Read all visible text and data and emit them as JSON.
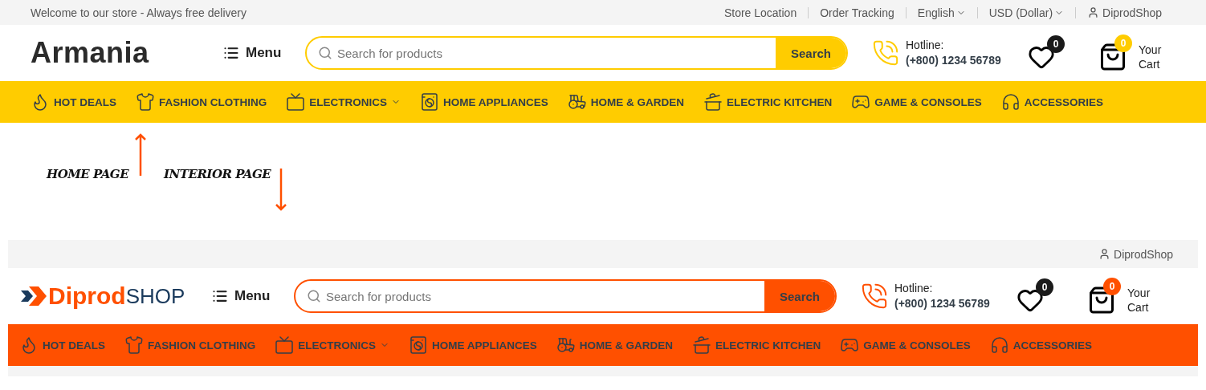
{
  "home_header": {
    "kind": "home",
    "top_bar": {
      "welcome": "Welcome to our store - Always free delivery",
      "links": [
        {
          "label": "Store Location",
          "dropdown": false
        },
        {
          "label": "Order Tracking",
          "dropdown": false
        },
        {
          "label": "English",
          "dropdown": true
        },
        {
          "label": "USD (Dollar)",
          "dropdown": true
        }
      ],
      "account": "DiprodShop"
    },
    "logo": {
      "text": "Armania"
    },
    "menu_label": "Menu",
    "search": {
      "placeholder": "Search for products",
      "button": "Search"
    },
    "hotline": {
      "label": "Hotline:",
      "number": "(+800) 1234 56789"
    },
    "wishlist_count": "0",
    "cart": {
      "count": "0",
      "label": "Your Cart"
    },
    "categories": [
      {
        "label": "HOT DEALS",
        "dropdown": false
      },
      {
        "label": "FASHION CLOTHING",
        "dropdown": false
      },
      {
        "label": "ELECTRONICS",
        "dropdown": true
      },
      {
        "label": "HOME APPLIANCES",
        "dropdown": false
      },
      {
        "label": "HOME & GARDEN",
        "dropdown": false
      },
      {
        "label": "ELECTRIC KITCHEN",
        "dropdown": false
      },
      {
        "label": "GAME & CONSOLES",
        "dropdown": false
      },
      {
        "label": "ACCESSORIES",
        "dropdown": false
      }
    ]
  },
  "annotations": [
    {
      "label": "HOME PAGE",
      "points_up": true
    },
    {
      "label": "INTERIOR PAGE",
      "points_up": false
    }
  ],
  "interior_header": {
    "kind": "interior",
    "top_bar": {
      "account": "DiprodShop"
    },
    "logo": {
      "text": "Diprod",
      "text_2": "SHOP"
    },
    "menu_label": "Menu",
    "search": {
      "placeholder": "Search for products",
      "button": "Search"
    },
    "hotline": {
      "label": "Hotline:",
      "number": "(+800) 1234 56789"
    },
    "wishlist_count": "0",
    "cart": {
      "count": "0",
      "label": "Your Cart"
    },
    "categories": [
      {
        "label": "HOT DEALS",
        "dropdown": false
      },
      {
        "label": "FASHION CLOTHING",
        "dropdown": false
      },
      {
        "label": "ELECTRONICS",
        "dropdown": true
      },
      {
        "label": "HOME APPLIANCES",
        "dropdown": false
      },
      {
        "label": "HOME & GARDEN",
        "dropdown": false
      },
      {
        "label": "ELECTRIC KITCHEN",
        "dropdown": false
      },
      {
        "label": "GAME & CONSOLES",
        "dropdown": false
      },
      {
        "label": "ACCESSORIES",
        "dropdown": false
      }
    ]
  }
}
